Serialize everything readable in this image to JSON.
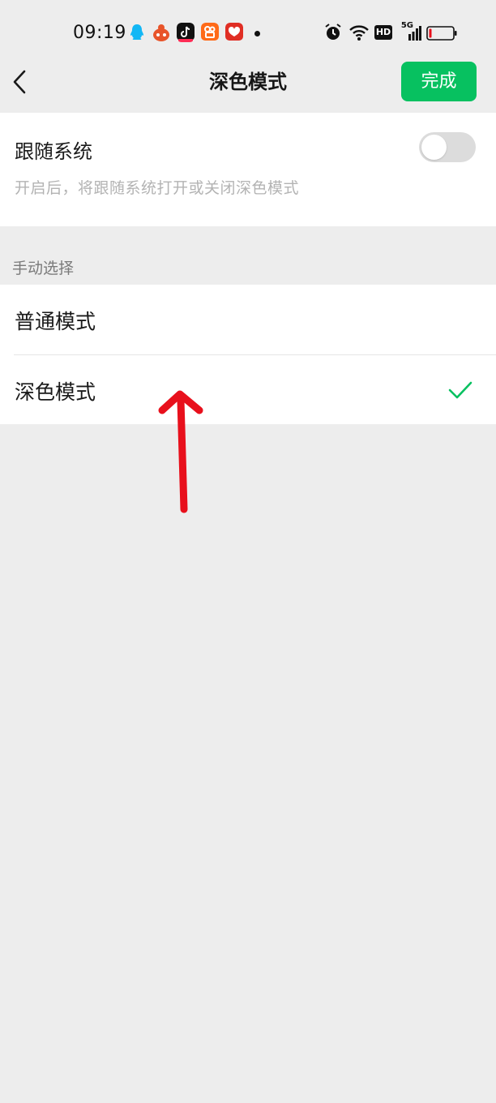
{
  "status_bar": {
    "time": "09:19",
    "app_icons": [
      "qq-icon",
      "taobao-icon",
      "douyin-icon",
      "kuaishou-icon",
      "pinduoduo-icon"
    ],
    "system_icons": [
      "alarm-icon",
      "wifi-icon",
      "hd-icon",
      "signal-5g-icon",
      "battery-icon"
    ],
    "hd_label": "HD",
    "network_label": "5G"
  },
  "nav": {
    "title": "深色模式",
    "done_label": "完成"
  },
  "follow_system": {
    "title": "跟随系统",
    "description": "开启后，将跟随系统打开或关闭深色模式",
    "enabled": false
  },
  "manual": {
    "section_label": "手动选择",
    "options": [
      {
        "label": "普通模式",
        "selected": false
      },
      {
        "label": "深色模式",
        "selected": true
      }
    ]
  },
  "colors": {
    "accent": "#07c160",
    "background": "#ededed",
    "annotation_arrow": "#e8101c"
  }
}
